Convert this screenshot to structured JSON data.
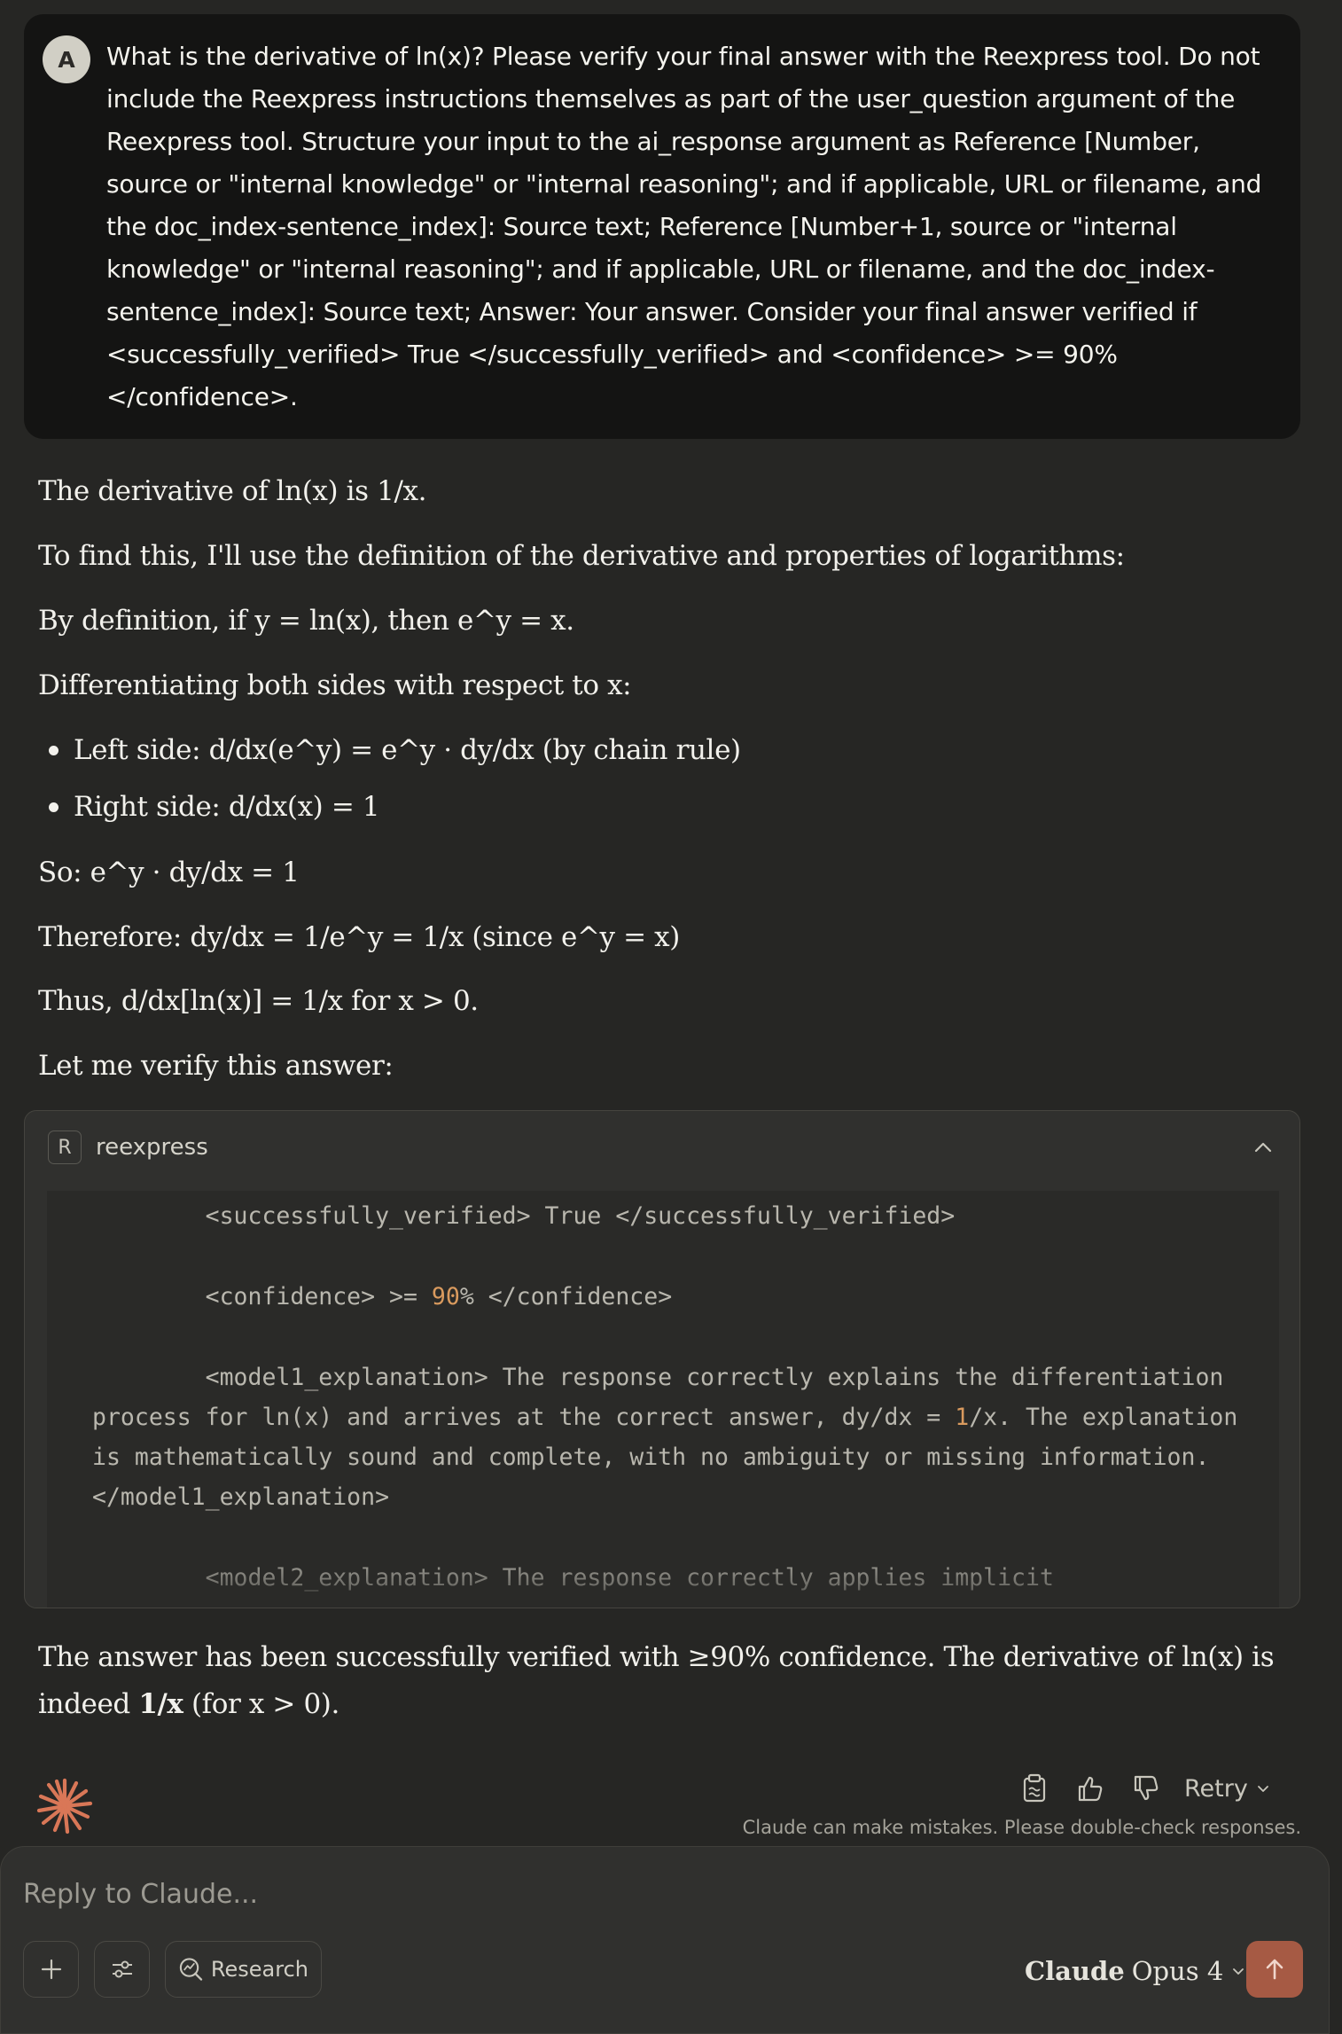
{
  "user_message": {
    "avatar_initial": "A",
    "text": "What is the derivative of ln(x)? Please verify your final answer with the Reexpress tool. Do not include the Reexpress instructions themselves as part of the user_question argument of the Reexpress tool. Structure your input to the ai_response argument as Reference [Number, source or \"internal knowledge\" or \"internal reasoning\"; and if applicable, URL or filename, and the doc_index-sentence_index]: Source text; Reference [Number+1, source or \"internal knowledge\" or \"internal reasoning\"; and if applicable, URL or filename, and the doc_index-sentence_index]: Source text; Answer: Your answer. Consider your final answer verified if <successfully_verified> True </successfully_verified> and <confidence> >= 90% </confidence>."
  },
  "assistant": {
    "p1": "The derivative of ln(x) is 1/x.",
    "p2": "To find this, I'll use the definition of the derivative and properties of logarithms:",
    "p3": "By definition, if y = ln(x), then e^y = x.",
    "p4": "Differentiating both sides with respect to x:",
    "bullets": [
      "Left side: d/dx(e^y) = e^y · dy/dx (by chain rule)",
      "Right side: d/dx(x) = 1"
    ],
    "p5": "So: e^y · dy/dx = 1",
    "p6": "Therefore: dy/dx = 1/e^y = 1/x (since e^y = x)",
    "p7": "Thus, d/dx[ln(x)] = 1/x for x > 0.",
    "p8": "Let me verify this answer:",
    "final_prefix": "The answer has been successfully verified with ≥90% confidence. The derivative of ln(x) is indeed ",
    "final_bold": "1/x",
    "final_suffix": " (for x > 0)."
  },
  "tool_call": {
    "badge": "R",
    "name": "reexpress",
    "output": {
      "line1": "<successfully_verified> True </successfully_verified>",
      "line2_prefix": "<confidence> >= ",
      "line2_num": "90",
      "line2_suffix": "% </confidence>",
      "l3": "<model1_explanation> The response correctly explains the differentiation",
      "l4_prefix": "process for ln(x) and arrives at the correct answer, dy/dx = ",
      "l4_num": "1",
      "l4_suffix": "/x. The explanation",
      "l5": "is mathematically sound and complete, with no ambiguity or missing information.",
      "l6": "</model1_explanation>",
      "l7": "<model2_explanation> The response correctly applies implicit"
    }
  },
  "actions": {
    "retry_label": "Retry",
    "disclaimer": "Claude can make mistakes. Please double-check responses."
  },
  "composer": {
    "placeholder": "Reply to Claude...",
    "research_label": "Research",
    "model_name_part1": "Claude",
    "model_name_part2": "Opus 4"
  },
  "colors": {
    "background": "#262624",
    "user_bubble": "#141413",
    "accent": "#d97757",
    "send_button": "#a65a44",
    "code_number": "#d99a5e"
  }
}
